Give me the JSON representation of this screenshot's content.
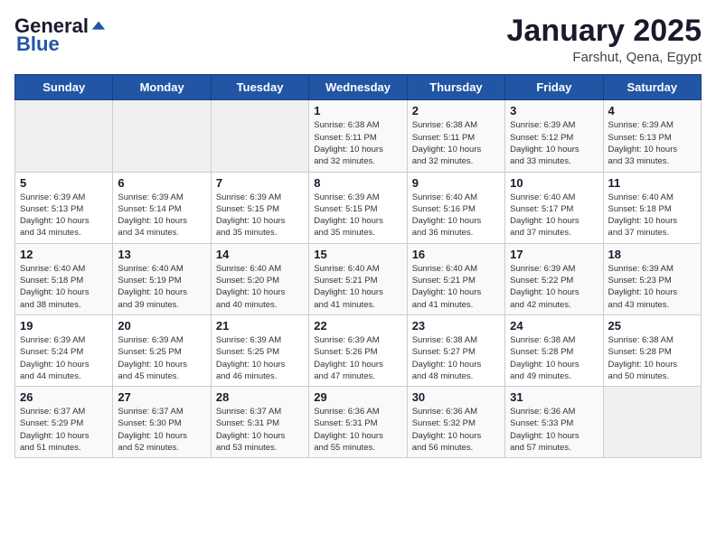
{
  "header": {
    "logo_general": "General",
    "logo_blue": "Blue",
    "month_title": "January 2025",
    "location": "Farshut, Qena, Egypt"
  },
  "days_of_week": [
    "Sunday",
    "Monday",
    "Tuesday",
    "Wednesday",
    "Thursday",
    "Friday",
    "Saturday"
  ],
  "weeks": [
    [
      {
        "day": "",
        "info": ""
      },
      {
        "day": "",
        "info": ""
      },
      {
        "day": "",
        "info": ""
      },
      {
        "day": "1",
        "info": "Sunrise: 6:38 AM\nSunset: 5:11 PM\nDaylight: 10 hours\nand 32 minutes."
      },
      {
        "day": "2",
        "info": "Sunrise: 6:38 AM\nSunset: 5:11 PM\nDaylight: 10 hours\nand 32 minutes."
      },
      {
        "day": "3",
        "info": "Sunrise: 6:39 AM\nSunset: 5:12 PM\nDaylight: 10 hours\nand 33 minutes."
      },
      {
        "day": "4",
        "info": "Sunrise: 6:39 AM\nSunset: 5:13 PM\nDaylight: 10 hours\nand 33 minutes."
      }
    ],
    [
      {
        "day": "5",
        "info": "Sunrise: 6:39 AM\nSunset: 5:13 PM\nDaylight: 10 hours\nand 34 minutes."
      },
      {
        "day": "6",
        "info": "Sunrise: 6:39 AM\nSunset: 5:14 PM\nDaylight: 10 hours\nand 34 minutes."
      },
      {
        "day": "7",
        "info": "Sunrise: 6:39 AM\nSunset: 5:15 PM\nDaylight: 10 hours\nand 35 minutes."
      },
      {
        "day": "8",
        "info": "Sunrise: 6:39 AM\nSunset: 5:15 PM\nDaylight: 10 hours\nand 35 minutes."
      },
      {
        "day": "9",
        "info": "Sunrise: 6:40 AM\nSunset: 5:16 PM\nDaylight: 10 hours\nand 36 minutes."
      },
      {
        "day": "10",
        "info": "Sunrise: 6:40 AM\nSunset: 5:17 PM\nDaylight: 10 hours\nand 37 minutes."
      },
      {
        "day": "11",
        "info": "Sunrise: 6:40 AM\nSunset: 5:18 PM\nDaylight: 10 hours\nand 37 minutes."
      }
    ],
    [
      {
        "day": "12",
        "info": "Sunrise: 6:40 AM\nSunset: 5:18 PM\nDaylight: 10 hours\nand 38 minutes."
      },
      {
        "day": "13",
        "info": "Sunrise: 6:40 AM\nSunset: 5:19 PM\nDaylight: 10 hours\nand 39 minutes."
      },
      {
        "day": "14",
        "info": "Sunrise: 6:40 AM\nSunset: 5:20 PM\nDaylight: 10 hours\nand 40 minutes."
      },
      {
        "day": "15",
        "info": "Sunrise: 6:40 AM\nSunset: 5:21 PM\nDaylight: 10 hours\nand 41 minutes."
      },
      {
        "day": "16",
        "info": "Sunrise: 6:40 AM\nSunset: 5:21 PM\nDaylight: 10 hours\nand 41 minutes."
      },
      {
        "day": "17",
        "info": "Sunrise: 6:39 AM\nSunset: 5:22 PM\nDaylight: 10 hours\nand 42 minutes."
      },
      {
        "day": "18",
        "info": "Sunrise: 6:39 AM\nSunset: 5:23 PM\nDaylight: 10 hours\nand 43 minutes."
      }
    ],
    [
      {
        "day": "19",
        "info": "Sunrise: 6:39 AM\nSunset: 5:24 PM\nDaylight: 10 hours\nand 44 minutes."
      },
      {
        "day": "20",
        "info": "Sunrise: 6:39 AM\nSunset: 5:25 PM\nDaylight: 10 hours\nand 45 minutes."
      },
      {
        "day": "21",
        "info": "Sunrise: 6:39 AM\nSunset: 5:25 PM\nDaylight: 10 hours\nand 46 minutes."
      },
      {
        "day": "22",
        "info": "Sunrise: 6:39 AM\nSunset: 5:26 PM\nDaylight: 10 hours\nand 47 minutes."
      },
      {
        "day": "23",
        "info": "Sunrise: 6:38 AM\nSunset: 5:27 PM\nDaylight: 10 hours\nand 48 minutes."
      },
      {
        "day": "24",
        "info": "Sunrise: 6:38 AM\nSunset: 5:28 PM\nDaylight: 10 hours\nand 49 minutes."
      },
      {
        "day": "25",
        "info": "Sunrise: 6:38 AM\nSunset: 5:28 PM\nDaylight: 10 hours\nand 50 minutes."
      }
    ],
    [
      {
        "day": "26",
        "info": "Sunrise: 6:37 AM\nSunset: 5:29 PM\nDaylight: 10 hours\nand 51 minutes."
      },
      {
        "day": "27",
        "info": "Sunrise: 6:37 AM\nSunset: 5:30 PM\nDaylight: 10 hours\nand 52 minutes."
      },
      {
        "day": "28",
        "info": "Sunrise: 6:37 AM\nSunset: 5:31 PM\nDaylight: 10 hours\nand 53 minutes."
      },
      {
        "day": "29",
        "info": "Sunrise: 6:36 AM\nSunset: 5:31 PM\nDaylight: 10 hours\nand 55 minutes."
      },
      {
        "day": "30",
        "info": "Sunrise: 6:36 AM\nSunset: 5:32 PM\nDaylight: 10 hours\nand 56 minutes."
      },
      {
        "day": "31",
        "info": "Sunrise: 6:36 AM\nSunset: 5:33 PM\nDaylight: 10 hours\nand 57 minutes."
      },
      {
        "day": "",
        "info": ""
      }
    ]
  ]
}
